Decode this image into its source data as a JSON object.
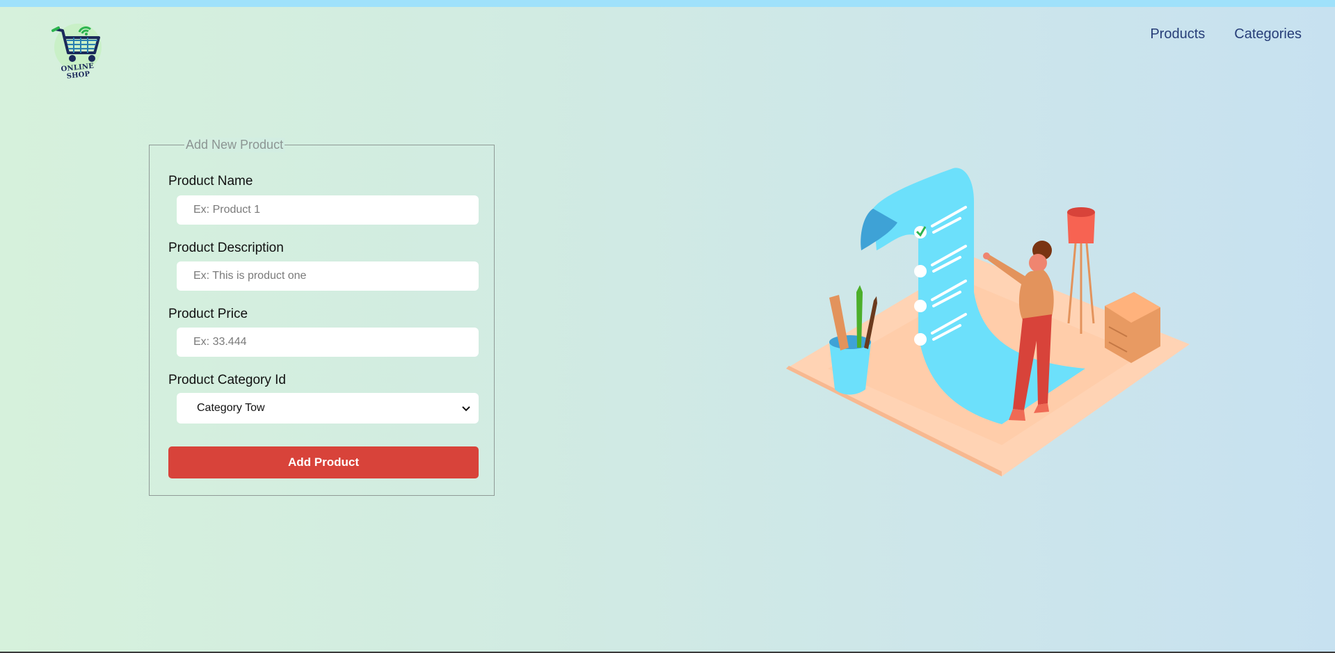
{
  "logo": {
    "text": "ONLINE SHOP",
    "icon": "cart-wifi-icon"
  },
  "nav": {
    "products": "Products",
    "categories": "Categories"
  },
  "form": {
    "legend": "Add New Product",
    "name_label": "Product Name",
    "name_placeholder": "Ex: Product 1",
    "description_label": "Product Description",
    "description_placeholder": "Ex: This is product one",
    "price_label": "Product Price",
    "price_placeholder": "Ex: 33.444",
    "category_label": "Product Category Id",
    "category_selected": "Category Tow",
    "submit_label": "Add Product"
  },
  "colors": {
    "accent": "#d8433a",
    "nav_text": "#273e78",
    "top_strip": "#9fe1fb"
  }
}
